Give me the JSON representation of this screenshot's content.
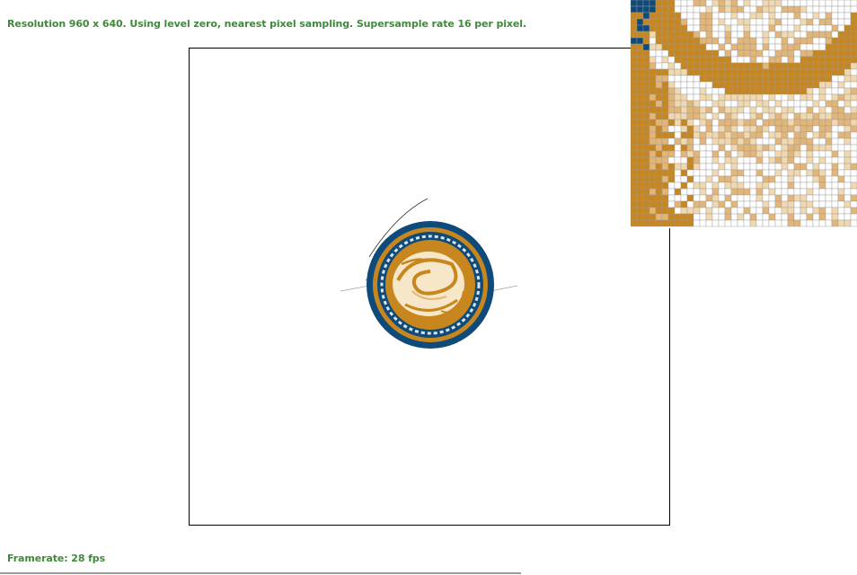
{
  "hud": {
    "status": "Resolution 960 x 640. Using level zero, nearest pixel sampling. Supersample rate 16 per pixel.",
    "framerate": "Framerate: 28 fps"
  },
  "colors": {
    "hud_text": "#3e8a3a",
    "seal_blue": "#0e4a7a",
    "seal_gold": "#c8871e",
    "seal_cream": "#f6e7c8",
    "light_gold": "#e3b678",
    "pale_gold": "#f1d8ae",
    "frame": "#000000"
  }
}
